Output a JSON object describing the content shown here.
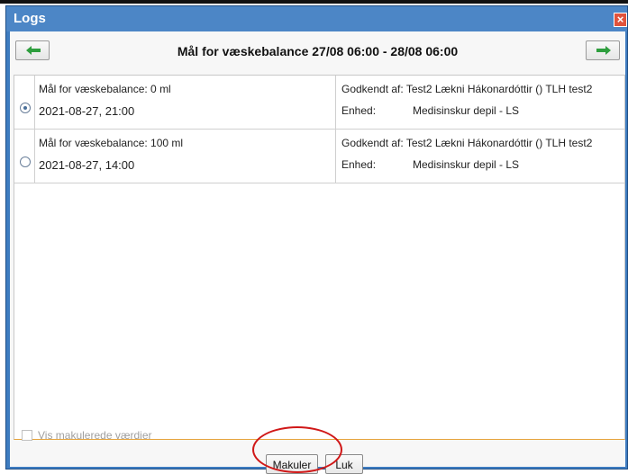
{
  "window": {
    "title": "Logs",
    "close_symbol": "×"
  },
  "nav": {
    "title": "Mål for væskebalance 27/08 06:00 - 28/08 06:00",
    "prev_icon": "arrow-left-icon",
    "next_icon": "arrow-right-icon",
    "arrow_color": "#2e9e3e"
  },
  "entries": [
    {
      "selected": true,
      "title": "Mål for væskebalance: 0 ml",
      "date": "2021-08-27, 21:00",
      "approved": "Godkendt af: Test2 Lækni Hákonardóttir () TLH test2",
      "unit_label": "Enhed:",
      "unit_value": "Medisinskur depil - LS"
    },
    {
      "selected": false,
      "title": "Mål for væskebalance: 100 ml",
      "date": "2021-08-27, 14:00",
      "approved": "Godkendt af: Test2 Lækni Hákonardóttir () TLH test2",
      "unit_label": "Enhed:",
      "unit_value": "Medisinskur depil - LS"
    }
  ],
  "footer": {
    "show_voided_label": "Vis makulerede værdier",
    "makuler_label": "Makuler",
    "luk_label": "Luk"
  }
}
